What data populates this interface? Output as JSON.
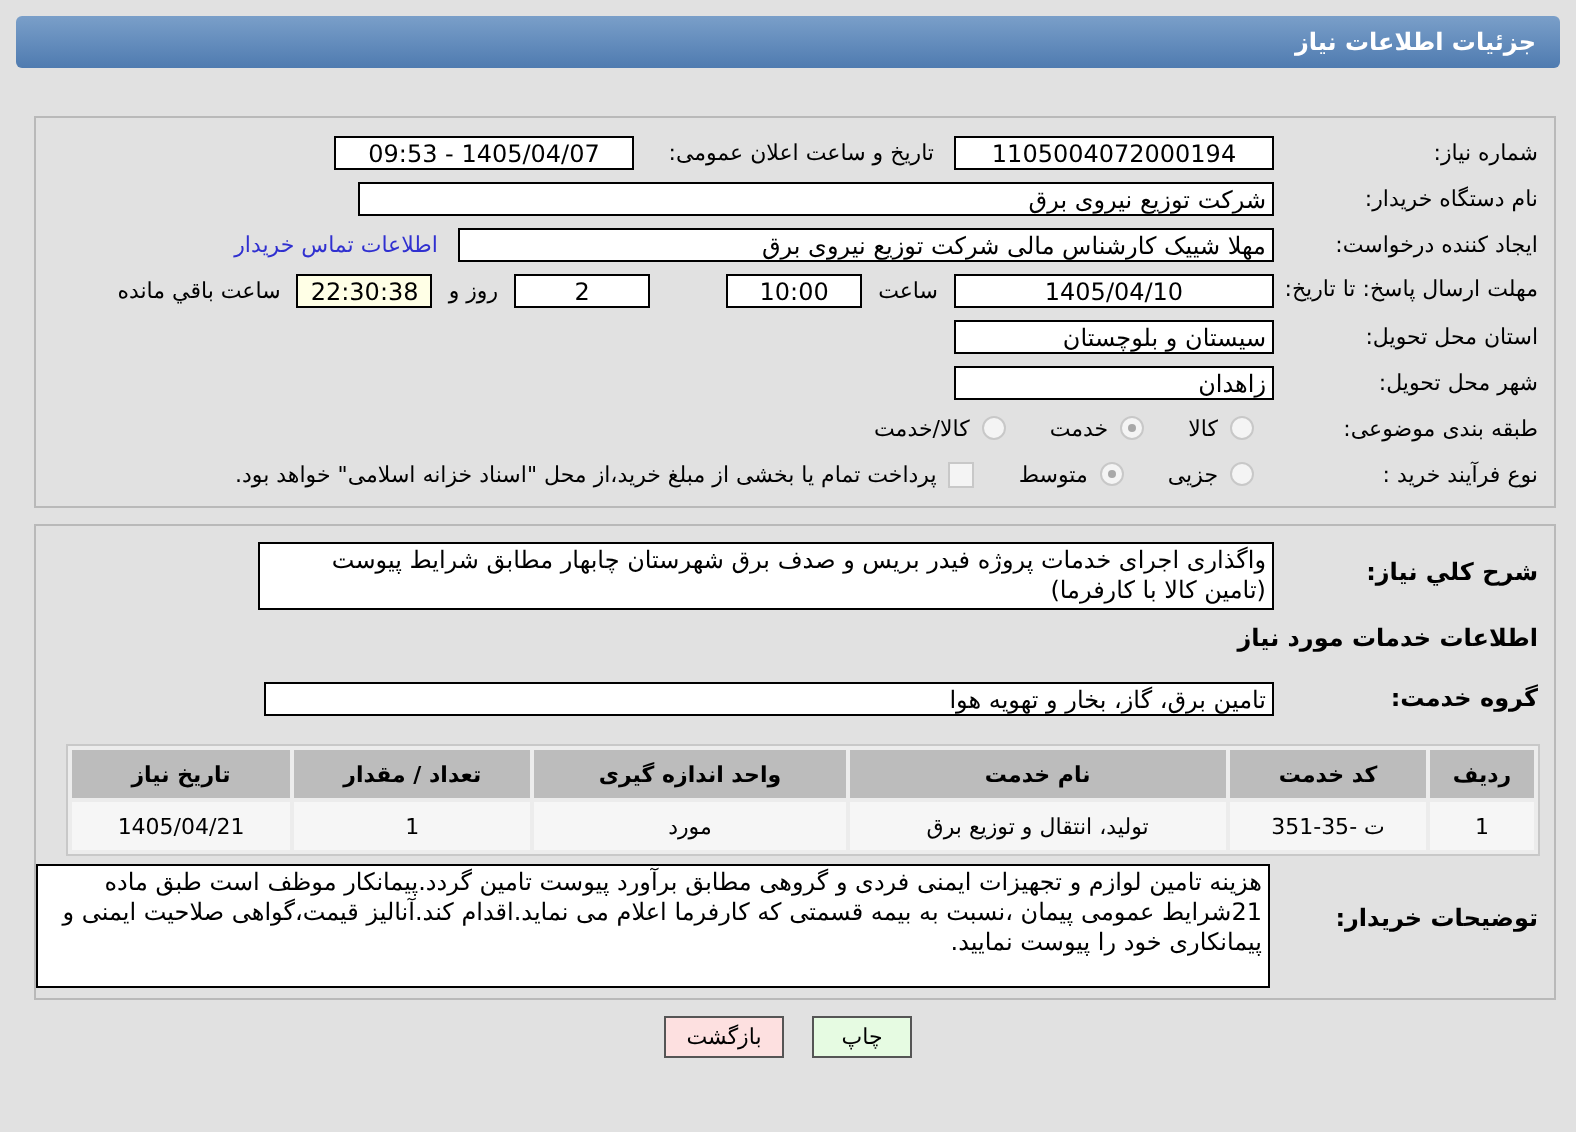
{
  "header": {
    "title": "جزئیات اطلاعات نیاز"
  },
  "details": {
    "need_number": {
      "label": "شماره نیاز:",
      "value": "1105004072000194"
    },
    "announce": {
      "label": "تاریخ و ساعت اعلان عمومی:",
      "value": "1405/04/07 - 09:53"
    },
    "buyer_org": {
      "label": "نام دستگاه خریدار:",
      "value": "شرکت توزیع نیروی برق"
    },
    "creator": {
      "label": "ایجاد کننده درخواست:",
      "value": "مهلا شییک کارشناس مالی شرکت توزیع نیروی برق",
      "link": "اطلاعات تماس خریدار"
    },
    "deadline": {
      "label": "مهلت ارسال پاسخ: تا تاریخ:",
      "date": "1405/04/10",
      "time_label": "ساعت",
      "time": "10:00",
      "days": "2",
      "days_label": "روز و",
      "remaining": "22:30:38",
      "remaining_label": "ساعت باقي مانده"
    },
    "province": {
      "label": "استان محل تحویل:",
      "value": "سیستان و بلوچستان"
    },
    "city": {
      "label": "شهر محل تحویل:",
      "value": "زاهدان"
    },
    "category": {
      "label": "طبقه بندی موضوعی:",
      "options": [
        {
          "label": "کالا",
          "selected": false
        },
        {
          "label": "خدمت",
          "selected": true
        },
        {
          "label": "کالا/خدمت",
          "selected": false
        }
      ]
    },
    "process": {
      "label": "نوع فرآیند خرید :",
      "options": [
        {
          "label": "جزیی",
          "selected": false
        },
        {
          "label": "متوسط",
          "selected": true
        }
      ],
      "payment": {
        "checked": false,
        "text": "پرداخت تمام یا بخشی از مبلغ خرید،از محل \"اسناد خزانه اسلامی\" خواهد بود."
      }
    }
  },
  "needs": {
    "summary": {
      "label": "شرح کلي نياز:",
      "value": "واگذاری اجرای خدمات پروژه فیدر بریس و صدف برق شهرستان چابهار مطابق شرایط پیوست (تامین کالا با کارفرما)"
    },
    "services_title": "اطلاعات خدمات مورد نياز",
    "group": {
      "label": "گروه خدمت:",
      "value": "تامین برق، گاز، بخار و تهویه هوا"
    },
    "table": {
      "columns": [
        "ردیف",
        "کد خدمت",
        "نام خدمت",
        "واحد اندازه گیری",
        "تعداد / مقدار",
        "تاریخ نیاز"
      ],
      "rows": [
        [
          "1",
          "ت -35-351",
          "تولید، انتقال و توزیع برق",
          "مورد",
          "1",
          "1405/04/21"
        ]
      ]
    },
    "notes": {
      "label": "توضیحات خریدار:",
      "value": "هزینه تامین لوازم و تجهیزات ایمنی فردی و گروهی مطابق برآورد پیوست تامین گردد.پیمانکار موظف است طبق ماده 21شرایط عمومی پیمان ،نسبت به بیمه قسمتی که کارفرما اعلام می نماید.اقدام کند.آنالیز قیمت،گواهی صلاحیت ایمنی و پیمانکاری خود را پیوست نمایید."
    }
  },
  "buttons": [
    {
      "label": "چاپ",
      "kind": "print"
    },
    {
      "label": "بازگشت",
      "kind": "back"
    }
  ]
}
